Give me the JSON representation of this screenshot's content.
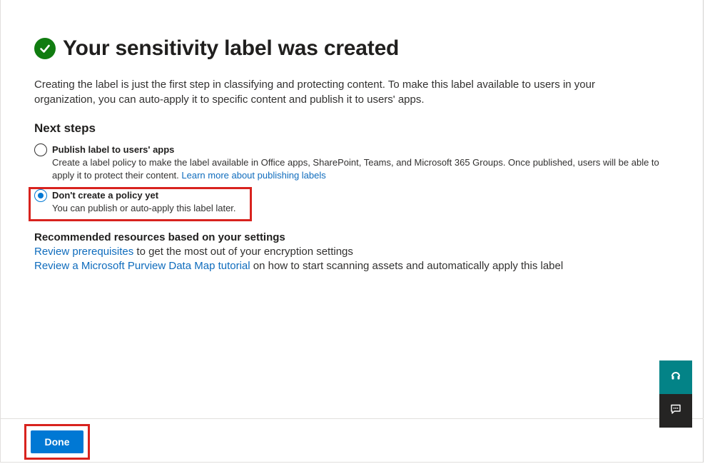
{
  "page": {
    "title": "Your sensitivity label was created",
    "intro": "Creating the label is just the first step in classifying and protecting content. To make this label available to users in your organization, you can auto-apply it to specific content and publish it to users' apps."
  },
  "next_steps": {
    "heading": "Next steps",
    "options": [
      {
        "label": "Publish label to users' apps",
        "description": "Create a label policy to make the label available in Office apps, SharePoint, Teams, and Microsoft 365 Groups. Once published, users will be able to apply it to protect their content.",
        "link": "Learn more about publishing labels",
        "selected": false
      },
      {
        "label": "Don't create a policy yet",
        "description": "You can publish or auto-apply this label later.",
        "selected": true
      }
    ]
  },
  "resources": {
    "heading": "Recommended resources based on your settings",
    "items": [
      {
        "link": "Review prerequisites",
        "text": " to get the most out of your encryption settings"
      },
      {
        "link": "Review a Microsoft Purview Data Map tutorial",
        "text": " on how to start scanning assets and automatically apply this label"
      }
    ]
  },
  "footer": {
    "done_label": "Done"
  },
  "side_actions": {
    "help_icon": "headset-icon",
    "feedback_icon": "feedback-icon"
  },
  "colors": {
    "accent": "#0078d4",
    "success": "#107c10",
    "link": "#0f6cbd",
    "highlight": "#d8231e",
    "help_bg": "#038387",
    "feedback_bg": "#252423"
  }
}
